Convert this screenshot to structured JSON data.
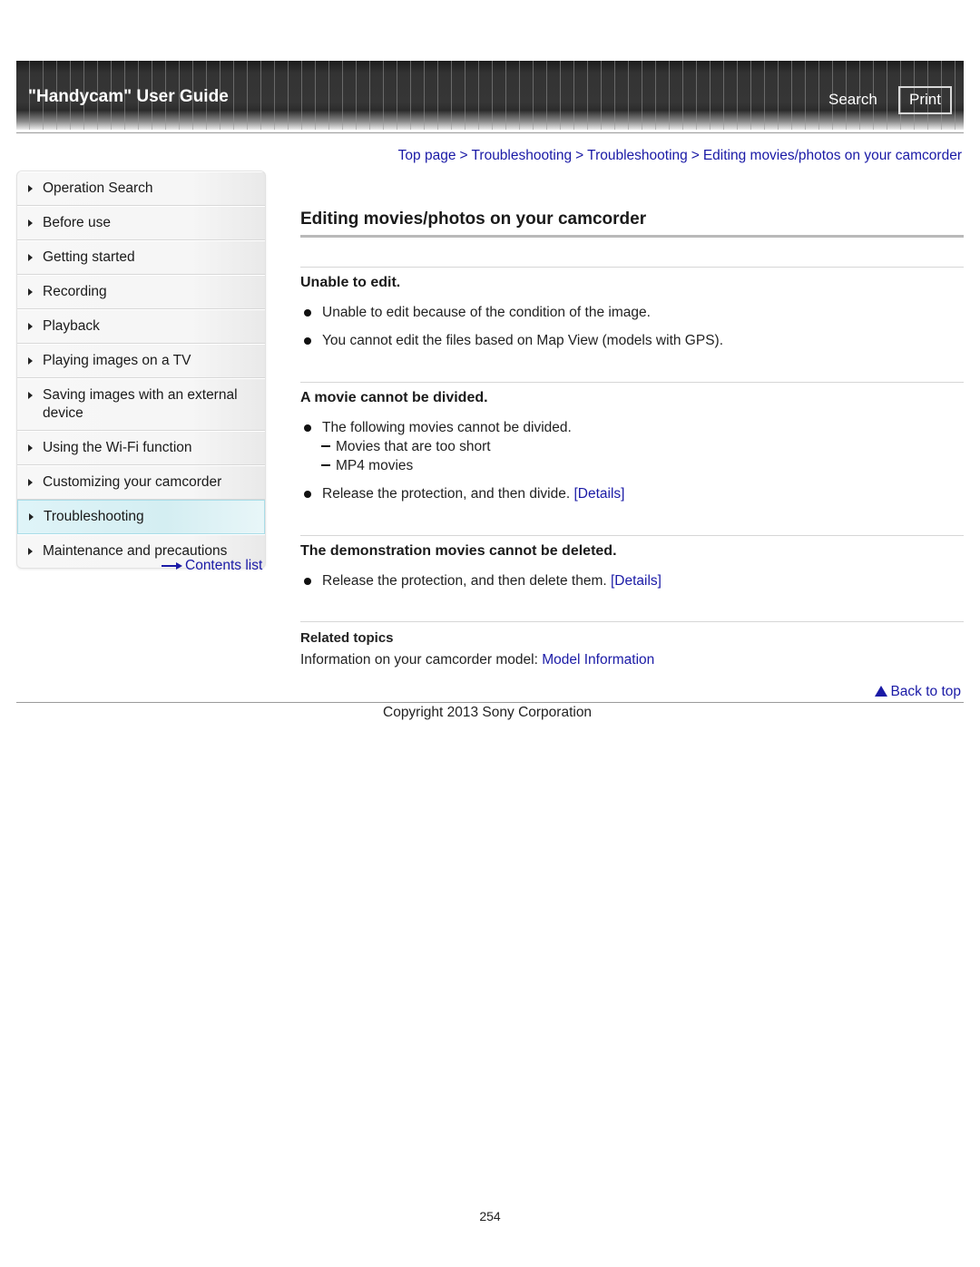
{
  "header": {
    "title": "\"Handycam\" User Guide",
    "search_label": "Search",
    "print_label": "Print"
  },
  "breadcrumb": [
    {
      "label": "Top page"
    },
    {
      "label": "Troubleshooting"
    },
    {
      "label": "Troubleshooting"
    },
    {
      "label": "Editing movies/photos on your camcorder"
    }
  ],
  "breadcrumb_separator": ">",
  "sidebar": {
    "items": [
      {
        "label": "Operation Search",
        "icon": "triangle-right-icon"
      },
      {
        "label": "Before use",
        "icon": "triangle-right-icon"
      },
      {
        "label": "Getting started",
        "icon": "triangle-right-icon"
      },
      {
        "label": "Recording",
        "icon": "triangle-right-icon"
      },
      {
        "label": "Playback",
        "icon": "triangle-right-icon"
      },
      {
        "label": "Playing images on a TV",
        "icon": "triangle-right-icon"
      },
      {
        "label": "Saving images with an external device",
        "icon": "triangle-right-icon"
      },
      {
        "label": "Using the Wi-Fi function",
        "icon": "triangle-right-icon"
      },
      {
        "label": "Customizing your camcorder",
        "icon": "triangle-right-icon"
      },
      {
        "label": "Troubleshooting",
        "icon": "triangle-right-icon",
        "active": true
      },
      {
        "label": "Maintenance and precautions",
        "icon": "triangle-right-icon"
      }
    ],
    "contents_link": "Contents list"
  },
  "main": {
    "title": "Editing movies/photos on your camcorder",
    "sections": [
      {
        "title": "Unable to edit.",
        "bullets": [
          {
            "text": "Unable to edit because of the condition of the image."
          },
          {
            "text": "You cannot edit the files based on Map View (models with GPS)."
          }
        ]
      },
      {
        "title": "A movie cannot be divided.",
        "bullets": [
          {
            "text": "The following movies cannot be divided.",
            "subitems": [
              "Movies that are too short",
              "MP4 movies"
            ]
          },
          {
            "text": "Release the protection, and then divide.",
            "link": "[Details]"
          }
        ]
      },
      {
        "title": "The demonstration movies cannot be deleted.",
        "bullets": [
          {
            "text": "Release the protection, and then delete them.",
            "link": "[Details]"
          }
        ]
      }
    ],
    "related": {
      "title": "Related topics",
      "text": "Information on your camcorder model:",
      "link": "Model Information"
    }
  },
  "footer": {
    "back_to_top": "Back to top",
    "copyright": "Copyright 2013 Sony Corporation",
    "page_number": "254"
  },
  "colors": {
    "link": "#1a1aa6",
    "header_bg": "#333333",
    "active_nav": "#d4eef2"
  }
}
